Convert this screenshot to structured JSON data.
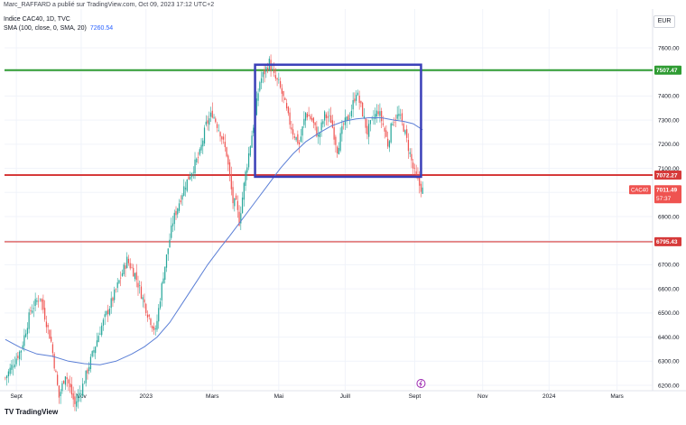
{
  "header": {
    "author_line": "Marc_RAFFARD a publié sur TradingView.com, Oct 09, 2023 17:12 UTC+2",
    "symbol_line": "Indice CAC40, 1D, TVC",
    "indicator_label": "SMA (100, close, 0, SMA, 20)",
    "indicator_value": "7260.54",
    "currency": "EUR"
  },
  "branding": {
    "logo": "TV",
    "name": "TradingView"
  },
  "colors": {
    "up": "#26a69a",
    "down": "#ef5350",
    "sma": "#5b7fd6",
    "resistance": "#2e9b32",
    "support": "#d63a3a",
    "range_box": "#3a3fb8"
  },
  "chart_data": {
    "type": "candlestick",
    "title": "Indice CAC40, 1D, TVC",
    "ylim": [
      6180,
      7720
    ],
    "grid": true,
    "y_ticks": [
      6200,
      6300,
      6400,
      6500,
      6600,
      6700,
      6800,
      6900,
      7000,
      7100,
      7200,
      7300,
      7400,
      7500,
      7600
    ],
    "y_tick_labels": [
      "6200.00",
      "6300.00",
      "6400.00",
      "6500.00",
      "6600.00",
      "6700.00",
      "6800.00",
      "6900.00",
      "7000.00",
      "7100.00",
      "7200.00",
      "7300.00",
      "7400.00",
      "7500.00",
      "7600.00"
    ],
    "x_ticks": [
      {
        "label": "Sept",
        "idx": 7
      },
      {
        "label": "Nov",
        "idx": 48
      },
      {
        "label": "2023",
        "idx": 89
      },
      {
        "label": "Mars",
        "idx": 131
      },
      {
        "label": "Mai",
        "idx": 173
      },
      {
        "label": "Juill",
        "idx": 215
      },
      {
        "label": "Sept",
        "idx": 259
      },
      {
        "label": "Nov",
        "idx": 302
      },
      {
        "label": "2024",
        "idx": 344
      },
      {
        "label": "Mars",
        "idx": 387
      }
    ],
    "total_slots": 410,
    "anchors": [
      [
        0,
        6230
      ],
      [
        10,
        6350
      ],
      [
        16,
        6510
      ],
      [
        22,
        6570
      ],
      [
        29,
        6380
      ],
      [
        34,
        6150
      ],
      [
        38,
        6250
      ],
      [
        44,
        6120
      ],
      [
        49,
        6200
      ],
      [
        60,
        6430
      ],
      [
        68,
        6560
      ],
      [
        77,
        6720
      ],
      [
        82,
        6660
      ],
      [
        90,
        6500
      ],
      [
        95,
        6420
      ],
      [
        100,
        6660
      ],
      [
        106,
        6880
      ],
      [
        113,
        7020
      ],
      [
        118,
        7090
      ],
      [
        123,
        7160
      ],
      [
        127,
        7280
      ],
      [
        131,
        7330
      ],
      [
        136,
        7250
      ],
      [
        140,
        7160
      ],
      [
        144,
        6960
      ],
      [
        146,
        6950
      ],
      [
        148,
        6880
      ],
      [
        152,
        7080
      ],
      [
        157,
        7280
      ],
      [
        161,
        7460
      ],
      [
        164,
        7500
      ],
      [
        167,
        7540
      ],
      [
        170,
        7480
      ],
      [
        173,
        7450
      ],
      [
        176,
        7390
      ],
      [
        179,
        7310
      ],
      [
        182,
        7250
      ],
      [
        186,
        7200
      ],
      [
        190,
        7330
      ],
      [
        194,
        7300
      ],
      [
        198,
        7230
      ],
      [
        202,
        7320
      ],
      [
        206,
        7300
      ],
      [
        210,
        7180
      ],
      [
        214,
        7280
      ],
      [
        218,
        7320
      ],
      [
        222,
        7420
      ],
      [
        226,
        7330
      ],
      [
        229,
        7250
      ],
      [
        233,
        7310
      ],
      [
        236,
        7340
      ],
      [
        239,
        7280
      ],
      [
        242,
        7200
      ],
      [
        245,
        7300
      ],
      [
        249,
        7320
      ],
      [
        252,
        7270
      ],
      [
        256,
        7160
      ],
      [
        258,
        7100
      ],
      [
        260,
        7060
      ],
      [
        262,
        7030
      ],
      [
        264,
        7010
      ]
    ],
    "ohlc_note": "daily candles reconstructed from the price path",
    "sma": {
      "name": "SMA (100, close, 0, SMA, 20)",
      "last_value": 7260.54,
      "points": [
        [
          0,
          6390
        ],
        [
          10,
          6355
        ],
        [
          20,
          6330
        ],
        [
          30,
          6320
        ],
        [
          40,
          6300
        ],
        [
          50,
          6290
        ],
        [
          60,
          6285
        ],
        [
          70,
          6300
        ],
        [
          80,
          6330
        ],
        [
          88,
          6360
        ],
        [
          96,
          6400
        ],
        [
          104,
          6460
        ],
        [
          112,
          6540
        ],
        [
          120,
          6620
        ],
        [
          128,
          6700
        ],
        [
          136,
          6770
        ],
        [
          142,
          6820
        ],
        [
          150,
          6890
        ],
        [
          158,
          6960
        ],
        [
          166,
          7030
        ],
        [
          174,
          7100
        ],
        [
          182,
          7160
        ],
        [
          190,
          7210
        ],
        [
          198,
          7245
        ],
        [
          206,
          7275
        ],
        [
          214,
          7295
        ],
        [
          222,
          7305
        ],
        [
          230,
          7310
        ],
        [
          238,
          7310
        ],
        [
          246,
          7300
        ],
        [
          252,
          7295
        ],
        [
          258,
          7285
        ],
        [
          264,
          7260
        ]
      ]
    },
    "levels": [
      {
        "value": 7507.47,
        "label": "7507.47",
        "color": "#2e9b32"
      },
      {
        "value": 7072.27,
        "label": "7072.27",
        "color": "#d63a3a"
      },
      {
        "value": 6795.43,
        "label": "6795.43",
        "color": "#d63a3a"
      }
    ],
    "range_box": {
      "x_start": 158,
      "x_end": 263,
      "y_top": 7530,
      "y_bottom": 7065
    },
    "last_price": {
      "symbol": "CAC40",
      "value": "7011.49",
      "countdown": "57:37",
      "price": 7011.49
    },
    "marker_idx": 263
  }
}
